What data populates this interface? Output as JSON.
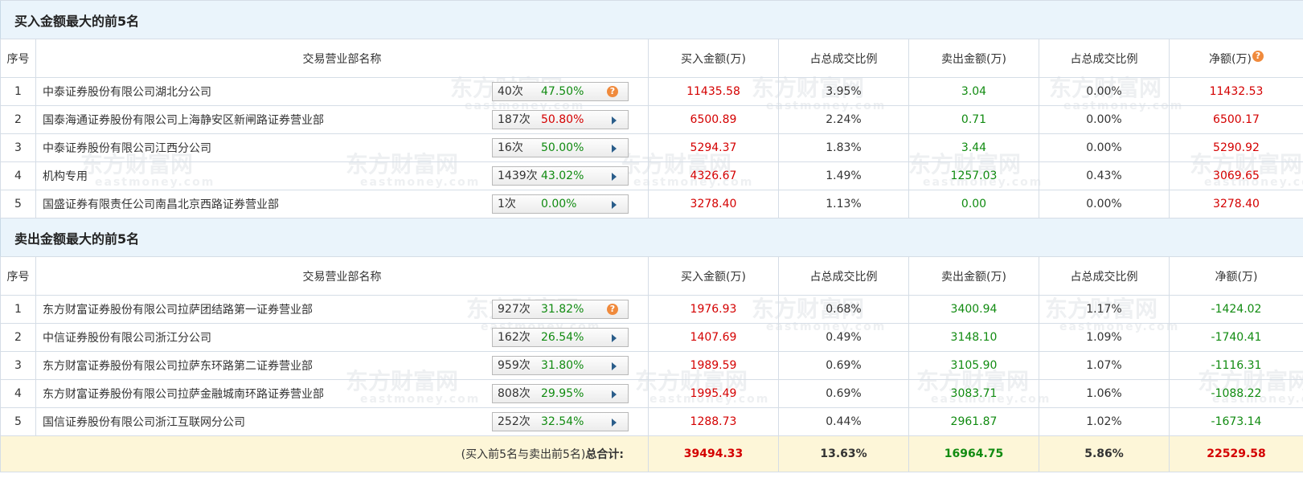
{
  "watermark": {
    "brand": "东方财富网",
    "domain": "eastmoney.com"
  },
  "buy_section": {
    "title": "买入金额最大的前5名",
    "headers": [
      "序号",
      "交易营业部名称",
      "买入金额(万)",
      "占总成交比例",
      "卖出金额(万)",
      "占总成交比例",
      "净额(万)"
    ],
    "net_help_icon": "question-icon",
    "rows": [
      {
        "idx": "1",
        "name": "中泰证券股份有限公司湖北分公司",
        "times": "40次",
        "rate": "47.50%",
        "buy": "11435.58",
        "buy_pct": "3.95%",
        "sell": "3.04",
        "sell_pct": "0.00%",
        "net": "11432.53",
        "icon": "question-icon"
      },
      {
        "idx": "2",
        "name": "国泰海通证券股份有限公司上海静安区新闸路证券营业部",
        "times": "187次",
        "rate": "50.80%",
        "buy": "6500.89",
        "buy_pct": "2.24%",
        "sell": "0.71",
        "sell_pct": "0.00%",
        "net": "6500.17",
        "icon": "arrow-right-icon"
      },
      {
        "idx": "3",
        "name": "中泰证券股份有限公司江西分公司",
        "times": "16次",
        "rate": "50.00%",
        "buy": "5294.37",
        "buy_pct": "1.83%",
        "sell": "3.44",
        "sell_pct": "0.00%",
        "net": "5290.92",
        "icon": "arrow-right-icon"
      },
      {
        "idx": "4",
        "name": "机构专用",
        "times": "1439次",
        "rate": "43.02%",
        "buy": "4326.67",
        "buy_pct": "1.49%",
        "sell": "1257.03",
        "sell_pct": "0.43%",
        "net": "3069.65",
        "icon": "arrow-right-icon"
      },
      {
        "idx": "5",
        "name": "国盛证券有限责任公司南昌北京西路证券营业部",
        "times": "1次",
        "rate": "0.00%",
        "buy": "3278.40",
        "buy_pct": "1.13%",
        "sell": "0.00",
        "sell_pct": "0.00%",
        "net": "3278.40",
        "icon": "arrow-right-icon"
      }
    ]
  },
  "sell_section": {
    "title": "卖出金额最大的前5名",
    "headers": [
      "序号",
      "交易营业部名称",
      "买入金额(万)",
      "占总成交比例",
      "卖出金额(万)",
      "占总成交比例",
      "净额(万)"
    ],
    "rows": [
      {
        "idx": "1",
        "name": "东方财富证券股份有限公司拉萨团结路第一证券营业部",
        "times": "927次",
        "rate": "31.82%",
        "buy": "1976.93",
        "buy_pct": "0.68%",
        "sell": "3400.94",
        "sell_pct": "1.17%",
        "net": "-1424.02",
        "icon": "question-icon"
      },
      {
        "idx": "2",
        "name": "中信证券股份有限公司浙江分公司",
        "times": "162次",
        "rate": "26.54%",
        "buy": "1407.69",
        "buy_pct": "0.49%",
        "sell": "3148.10",
        "sell_pct": "1.09%",
        "net": "-1740.41",
        "icon": "arrow-right-icon"
      },
      {
        "idx": "3",
        "name": "东方财富证券股份有限公司拉萨东环路第二证券营业部",
        "times": "959次",
        "rate": "31.80%",
        "buy": "1989.59",
        "buy_pct": "0.69%",
        "sell": "3105.90",
        "sell_pct": "1.07%",
        "net": "-1116.31",
        "icon": "arrow-right-icon"
      },
      {
        "idx": "4",
        "name": "东方财富证券股份有限公司拉萨金融城南环路证券营业部",
        "times": "808次",
        "rate": "29.95%",
        "buy": "1995.49",
        "buy_pct": "0.69%",
        "sell": "3083.71",
        "sell_pct": "1.06%",
        "net": "-1088.22",
        "icon": "arrow-right-icon"
      },
      {
        "idx": "5",
        "name": "国信证券股份有限公司浙江互联网分公司",
        "times": "252次",
        "rate": "32.54%",
        "buy": "1288.73",
        "buy_pct": "0.44%",
        "sell": "2961.87",
        "sell_pct": "1.02%",
        "net": "-1673.14",
        "icon": "arrow-right-icon"
      }
    ]
  },
  "total": {
    "label_paren": "(买入前5名与卖出前5名)",
    "label_bold": "总合计:",
    "buy": "39494.33",
    "buy_pct": "13.63%",
    "sell": "16964.75",
    "sell_pct": "5.86%",
    "net": "22529.58"
  },
  "colors": {
    "positive": "#d40000",
    "negative": "#118b11",
    "header_bg": "#eaf4fb",
    "total_bg": "#fdf6d8",
    "accent_icon": "#f08a3c"
  }
}
